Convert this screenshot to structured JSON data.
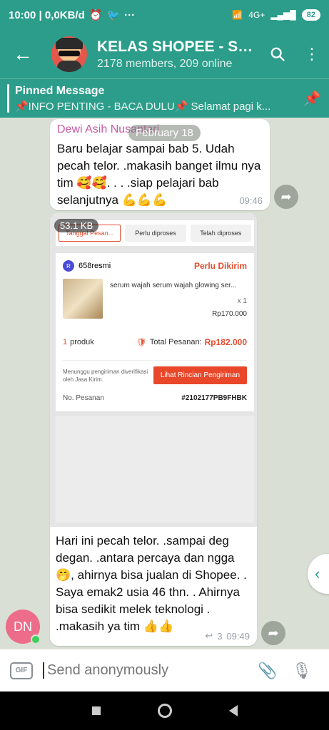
{
  "status_bar": {
    "time_speed": "10:00 | 0,0KB/d",
    "battery": "82",
    "signal": "4G+"
  },
  "header": {
    "back_icon": "arrow-left-icon",
    "title": "KELAS SHOPEE - SU...",
    "subtitle": "2178 members, 209 online"
  },
  "pinned": {
    "title": "Pinned Message",
    "body": "📌INFO PENTING - BACA DULU📌  Selamat pagi k..."
  },
  "chat": {
    "date_chip": "February 18",
    "message1": {
      "sender": "Dewi Asih Nusantari",
      "text": "Baru belajar sampai bab 5.  Udah pecah telor. .makasih banget ilmu nya tim 🥰🥰. . . .siap pelajari bab selanjutnya 💪💪💪",
      "time": "09:46"
    },
    "message2": {
      "file_size": "53.1 KB",
      "screenshot": {
        "tabs": [
          "Tanggal Pesan...",
          "Perlu diproses",
          "Telah diproses"
        ],
        "shop_name": "658resmi",
        "status": "Perlu Dikirim",
        "product_name": "serum wajah serum wajah glowing ser...",
        "quantity": "x 1",
        "price": "Rp170.000",
        "product_count": "1",
        "product_label": "produk",
        "total_label": "Total Pesanan:",
        "total_amount": "Rp182.000",
        "shipping_note": "Menunggu pengiriman diverifikasi oleh Jasa Kirim.",
        "shipping_button": "Lihat Rincian Pengiriman",
        "order_label": "No. Pesanan",
        "order_number": "#2102177PB9FHBK"
      },
      "caption": "Hari ini pecah telor. .sampai deg degan. .antara percaya dan ngga 🤭, ahirnya bisa jualan di Shopee. . Saya emak2 usia 46 thn. . Ahirnya bisa sedikit melek teknologi . .makasih ya tim 👍👍",
      "reply_count": "3",
      "time": "09:49"
    },
    "user_initials": "DN"
  },
  "composer": {
    "placeholder": "Send anonymously",
    "gif_label": "GIF"
  }
}
